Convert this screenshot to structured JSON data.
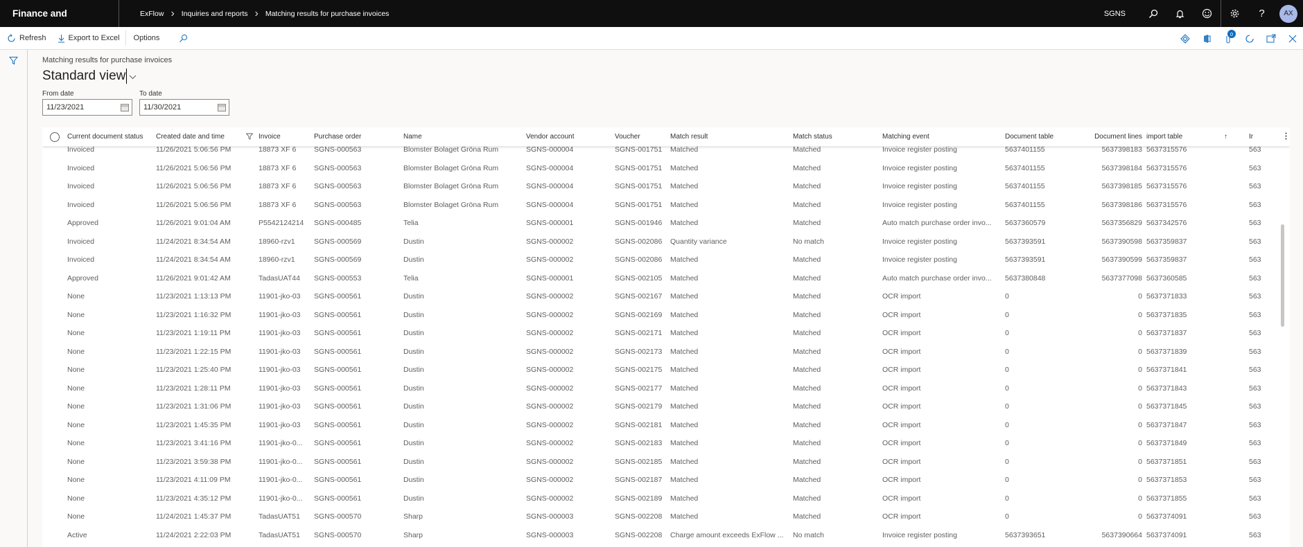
{
  "topbar": {
    "app_title": "Finance and Operations",
    "breadcrumbs": [
      "ExFlow",
      "Inquiries and reports",
      "Matching results for purchase invoices"
    ],
    "company": "SGNS",
    "avatar_initials": "AX",
    "icons": [
      "search-icon",
      "bell-icon",
      "smiley-icon",
      "gear-icon",
      "help-icon"
    ]
  },
  "actionbar": {
    "refresh_label": "Refresh",
    "export_label": "Export to Excel",
    "options_label": "Options",
    "notification_count": "0"
  },
  "page": {
    "caption": "Matching results for purchase invoices",
    "view_name": "Standard view",
    "from_date_label": "From date",
    "from_date_value": "11/23/2021",
    "to_date_label": "To date",
    "to_date_value": "11/30/2021"
  },
  "grid": {
    "columns": {
      "status": "Current document status",
      "created": "Created date and time",
      "invoice": "Invoice",
      "po": "Purchase order",
      "name": "Name",
      "vendor": "Vendor account",
      "voucher": "Voucher",
      "mresult": "Match result",
      "mstatus": "Match status",
      "event": "Matching event",
      "doctable": "Document table",
      "doclines": "Document lines",
      "import": "import table",
      "last": "Ir"
    },
    "rows": [
      {
        "status": "Invoiced",
        "created": "11/26/2021 5:06:56 PM",
        "invoice": "18873 XF 6",
        "po": "SGNS-000563",
        "name": "Blomster Bolaget Gröna Rum",
        "vendor": "SGNS-000004",
        "voucher": "SGNS-001751",
        "mresult": "Matched",
        "mstatus": "Matched",
        "event": "Invoice register posting",
        "doctable": "5637401155",
        "doclines": "5637398183",
        "import": "5637315576",
        "last": "563"
      },
      {
        "status": "Invoiced",
        "created": "11/26/2021 5:06:56 PM",
        "invoice": "18873 XF 6",
        "po": "SGNS-000563",
        "name": "Blomster Bolaget Gröna Rum",
        "vendor": "SGNS-000004",
        "voucher": "SGNS-001751",
        "mresult": "Matched",
        "mstatus": "Matched",
        "event": "Invoice register posting",
        "doctable": "5637401155",
        "doclines": "5637398184",
        "import": "5637315576",
        "last": "563"
      },
      {
        "status": "Invoiced",
        "created": "11/26/2021 5:06:56 PM",
        "invoice": "18873 XF 6",
        "po": "SGNS-000563",
        "name": "Blomster Bolaget Gröna Rum",
        "vendor": "SGNS-000004",
        "voucher": "SGNS-001751",
        "mresult": "Matched",
        "mstatus": "Matched",
        "event": "Invoice register posting",
        "doctable": "5637401155",
        "doclines": "5637398185",
        "import": "5637315576",
        "last": "563"
      },
      {
        "status": "Invoiced",
        "created": "11/26/2021 5:06:56 PM",
        "invoice": "18873 XF 6",
        "po": "SGNS-000563",
        "name": "Blomster Bolaget Gröna Rum",
        "vendor": "SGNS-000004",
        "voucher": "SGNS-001751",
        "mresult": "Matched",
        "mstatus": "Matched",
        "event": "Invoice register posting",
        "doctable": "5637401155",
        "doclines": "5637398186",
        "import": "5637315576",
        "last": "563"
      },
      {
        "status": "Approved",
        "created": "11/26/2021 9:01:04 AM",
        "invoice": "P5542124214",
        "po": "SGNS-000485",
        "name": "Telia",
        "vendor": "SGNS-000001",
        "voucher": "SGNS-001946",
        "mresult": "Matched",
        "mstatus": "Matched",
        "event": "Auto match purchase order invo...",
        "doctable": "5637360579",
        "doclines": "5637356829",
        "import": "5637342576",
        "last": "563"
      },
      {
        "status": "Invoiced",
        "created": "11/24/2021 8:34:54 AM",
        "invoice": "18960-rzv1",
        "po": "SGNS-000569",
        "name": "Dustin",
        "vendor": "SGNS-000002",
        "voucher": "SGNS-002086",
        "mresult": "Quantity variance",
        "mstatus": "No match",
        "event": "Invoice register posting",
        "doctable": "5637393591",
        "doclines": "5637390598",
        "import": "5637359837",
        "last": "563"
      },
      {
        "status": "Invoiced",
        "created": "11/24/2021 8:34:54 AM",
        "invoice": "18960-rzv1",
        "po": "SGNS-000569",
        "name": "Dustin",
        "vendor": "SGNS-000002",
        "voucher": "SGNS-002086",
        "mresult": "Matched",
        "mstatus": "Matched",
        "event": "Invoice register posting",
        "doctable": "5637393591",
        "doclines": "5637390599",
        "import": "5637359837",
        "last": "563"
      },
      {
        "status": "Approved",
        "created": "11/26/2021 9:01:42 AM",
        "invoice": "TadasUAT44",
        "po": "SGNS-000553",
        "name": "Telia",
        "vendor": "SGNS-000001",
        "voucher": "SGNS-002105",
        "mresult": "Matched",
        "mstatus": "Matched",
        "event": "Auto match purchase order invo...",
        "doctable": "5637380848",
        "doclines": "5637377098",
        "import": "5637360585",
        "last": "563"
      },
      {
        "status": "None",
        "created": "11/23/2021 1:13:13 PM",
        "invoice": "11901-jko-03",
        "po": "SGNS-000561",
        "name": "Dustin",
        "vendor": "SGNS-000002",
        "voucher": "SGNS-002167",
        "mresult": "Matched",
        "mstatus": "Matched",
        "event": "OCR import",
        "doctable": "0",
        "doclines": "0",
        "import": "5637371833",
        "last": "563"
      },
      {
        "status": "None",
        "created": "11/23/2021 1:16:32 PM",
        "invoice": "11901-jko-03",
        "po": "SGNS-000561",
        "name": "Dustin",
        "vendor": "SGNS-000002",
        "voucher": "SGNS-002169",
        "mresult": "Matched",
        "mstatus": "Matched",
        "event": "OCR import",
        "doctable": "0",
        "doclines": "0",
        "import": "5637371835",
        "last": "563"
      },
      {
        "status": "None",
        "created": "11/23/2021 1:19:11 PM",
        "invoice": "11901-jko-03",
        "po": "SGNS-000561",
        "name": "Dustin",
        "vendor": "SGNS-000002",
        "voucher": "SGNS-002171",
        "mresult": "Matched",
        "mstatus": "Matched",
        "event": "OCR import",
        "doctable": "0",
        "doclines": "0",
        "import": "5637371837",
        "last": "563"
      },
      {
        "status": "None",
        "created": "11/23/2021 1:22:15 PM",
        "invoice": "11901-jko-03",
        "po": "SGNS-000561",
        "name": "Dustin",
        "vendor": "SGNS-000002",
        "voucher": "SGNS-002173",
        "mresult": "Matched",
        "mstatus": "Matched",
        "event": "OCR import",
        "doctable": "0",
        "doclines": "0",
        "import": "5637371839",
        "last": "563"
      },
      {
        "status": "None",
        "created": "11/23/2021 1:25:40 PM",
        "invoice": "11901-jko-03",
        "po": "SGNS-000561",
        "name": "Dustin",
        "vendor": "SGNS-000002",
        "voucher": "SGNS-002175",
        "mresult": "Matched",
        "mstatus": "Matched",
        "event": "OCR import",
        "doctable": "0",
        "doclines": "0",
        "import": "5637371841",
        "last": "563"
      },
      {
        "status": "None",
        "created": "11/23/2021 1:28:11 PM",
        "invoice": "11901-jko-03",
        "po": "SGNS-000561",
        "name": "Dustin",
        "vendor": "SGNS-000002",
        "voucher": "SGNS-002177",
        "mresult": "Matched",
        "mstatus": "Matched",
        "event": "OCR import",
        "doctable": "0",
        "doclines": "0",
        "import": "5637371843",
        "last": "563"
      },
      {
        "status": "None",
        "created": "11/23/2021 1:31:06 PM",
        "invoice": "11901-jko-03",
        "po": "SGNS-000561",
        "name": "Dustin",
        "vendor": "SGNS-000002",
        "voucher": "SGNS-002179",
        "mresult": "Matched",
        "mstatus": "Matched",
        "event": "OCR import",
        "doctable": "0",
        "doclines": "0",
        "import": "5637371845",
        "last": "563"
      },
      {
        "status": "None",
        "created": "11/23/2021 1:45:35 PM",
        "invoice": "11901-jko-03",
        "po": "SGNS-000561",
        "name": "Dustin",
        "vendor": "SGNS-000002",
        "voucher": "SGNS-002181",
        "mresult": "Matched",
        "mstatus": "Matched",
        "event": "OCR import",
        "doctable": "0",
        "doclines": "0",
        "import": "5637371847",
        "last": "563"
      },
      {
        "status": "None",
        "created": "11/23/2021 3:41:16 PM",
        "invoice": "11901-jko-0...",
        "po": "SGNS-000561",
        "name": "Dustin",
        "vendor": "SGNS-000002",
        "voucher": "SGNS-002183",
        "mresult": "Matched",
        "mstatus": "Matched",
        "event": "OCR import",
        "doctable": "0",
        "doclines": "0",
        "import": "5637371849",
        "last": "563"
      },
      {
        "status": "None",
        "created": "11/23/2021 3:59:38 PM",
        "invoice": "11901-jko-0...",
        "po": "SGNS-000561",
        "name": "Dustin",
        "vendor": "SGNS-000002",
        "voucher": "SGNS-002185",
        "mresult": "Matched",
        "mstatus": "Matched",
        "event": "OCR import",
        "doctable": "0",
        "doclines": "0",
        "import": "5637371851",
        "last": "563"
      },
      {
        "status": "None",
        "created": "11/23/2021 4:11:09 PM",
        "invoice": "11901-jko-0...",
        "po": "SGNS-000561",
        "name": "Dustin",
        "vendor": "SGNS-000002",
        "voucher": "SGNS-002187",
        "mresult": "Matched",
        "mstatus": "Matched",
        "event": "OCR import",
        "doctable": "0",
        "doclines": "0",
        "import": "5637371853",
        "last": "563"
      },
      {
        "status": "None",
        "created": "11/23/2021 4:35:12 PM",
        "invoice": "11901-jko-0...",
        "po": "SGNS-000561",
        "name": "Dustin",
        "vendor": "SGNS-000002",
        "voucher": "SGNS-002189",
        "mresult": "Matched",
        "mstatus": "Matched",
        "event": "OCR import",
        "doctable": "0",
        "doclines": "0",
        "import": "5637371855",
        "last": "563"
      },
      {
        "status": "None",
        "created": "11/24/2021 1:45:37 PM",
        "invoice": "TadasUAT51",
        "po": "SGNS-000570",
        "name": "Sharp",
        "vendor": "SGNS-000003",
        "voucher": "SGNS-002208",
        "mresult": "Matched",
        "mstatus": "Matched",
        "event": "OCR import",
        "doctable": "0",
        "doclines": "0",
        "import": "5637374091",
        "last": "563"
      },
      {
        "status": "Active",
        "created": "11/24/2021 2:22:03 PM",
        "invoice": "TadasUAT51",
        "po": "SGNS-000570",
        "name": "Sharp",
        "vendor": "SGNS-000003",
        "voucher": "SGNS-002208",
        "mresult": "Charge amount exceeds ExFlow ...",
        "mstatus": "No match",
        "event": "Invoice register posting",
        "doctable": "5637393651",
        "doclines": "5637390664",
        "import": "5637374091",
        "last": "563"
      }
    ]
  }
}
